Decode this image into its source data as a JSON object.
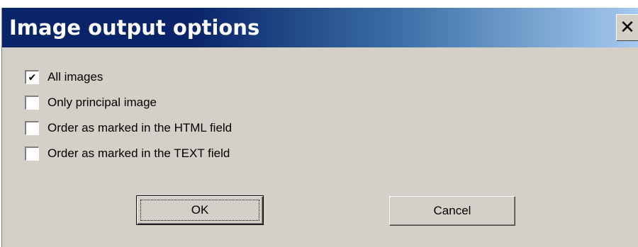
{
  "dialog": {
    "title": "Image output options",
    "close_icon": "close-icon",
    "close_glyph": "✕"
  },
  "options": [
    {
      "label": "All images",
      "checked": true
    },
    {
      "label": "Only principal image",
      "checked": false
    },
    {
      "label": "Order as marked in the HTML field",
      "checked": false
    },
    {
      "label": "Order as marked in the TEXT field",
      "checked": false
    }
  ],
  "buttons": {
    "ok_label": "OK",
    "cancel_label": "Cancel"
  },
  "colors": {
    "face": "#d4d0c8",
    "title_start": "#0a246a",
    "title_end": "#a6caf0"
  }
}
